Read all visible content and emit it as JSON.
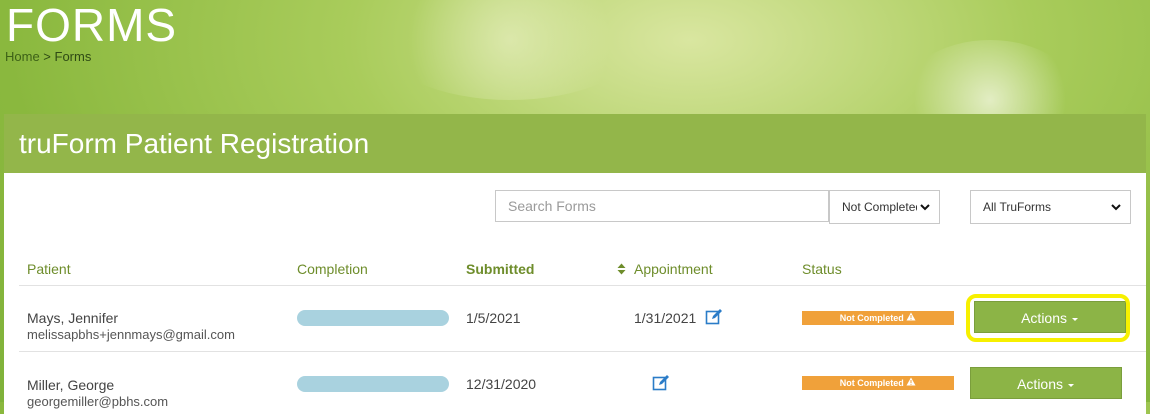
{
  "header": {
    "page_title": "FORMS",
    "breadcrumb_home": "Home",
    "breadcrumb_sep": " > ",
    "breadcrumb_current": "Forms"
  },
  "panel": {
    "title": "truForm Patient Registration"
  },
  "filters": {
    "search_placeholder": "Search Forms",
    "status_value": "Not Completed",
    "form_value": "All TruForms"
  },
  "table": {
    "columns": {
      "patient": "Patient",
      "completion": "Completion",
      "submitted": "Submitted",
      "appointment": "Appointment",
      "status": "Status"
    },
    "rows": [
      {
        "name": "Mays, Jennifer",
        "email": "melissapbhs+jennmays@gmail.com",
        "submitted": "1/5/2021",
        "appointment": "1/31/2021",
        "status": "Not Completed",
        "action": "Actions"
      },
      {
        "name": "Miller, George",
        "email": "georgemiller@pbhs.com",
        "submitted": "12/31/2020",
        "appointment": "",
        "status": "Not Completed",
        "action": "Actions"
      }
    ]
  },
  "icons": {
    "edit": "edit-icon",
    "warning": "warning-icon",
    "sort": "sort-icon",
    "chevron": "chevron-down-icon"
  },
  "colors": {
    "brand_green": "#93b64a",
    "header_text_green": "#6e8d2b",
    "status_orange": "#f0a13a",
    "progress_blue": "#a9d2df",
    "highlight_yellow": "#f7f000"
  }
}
